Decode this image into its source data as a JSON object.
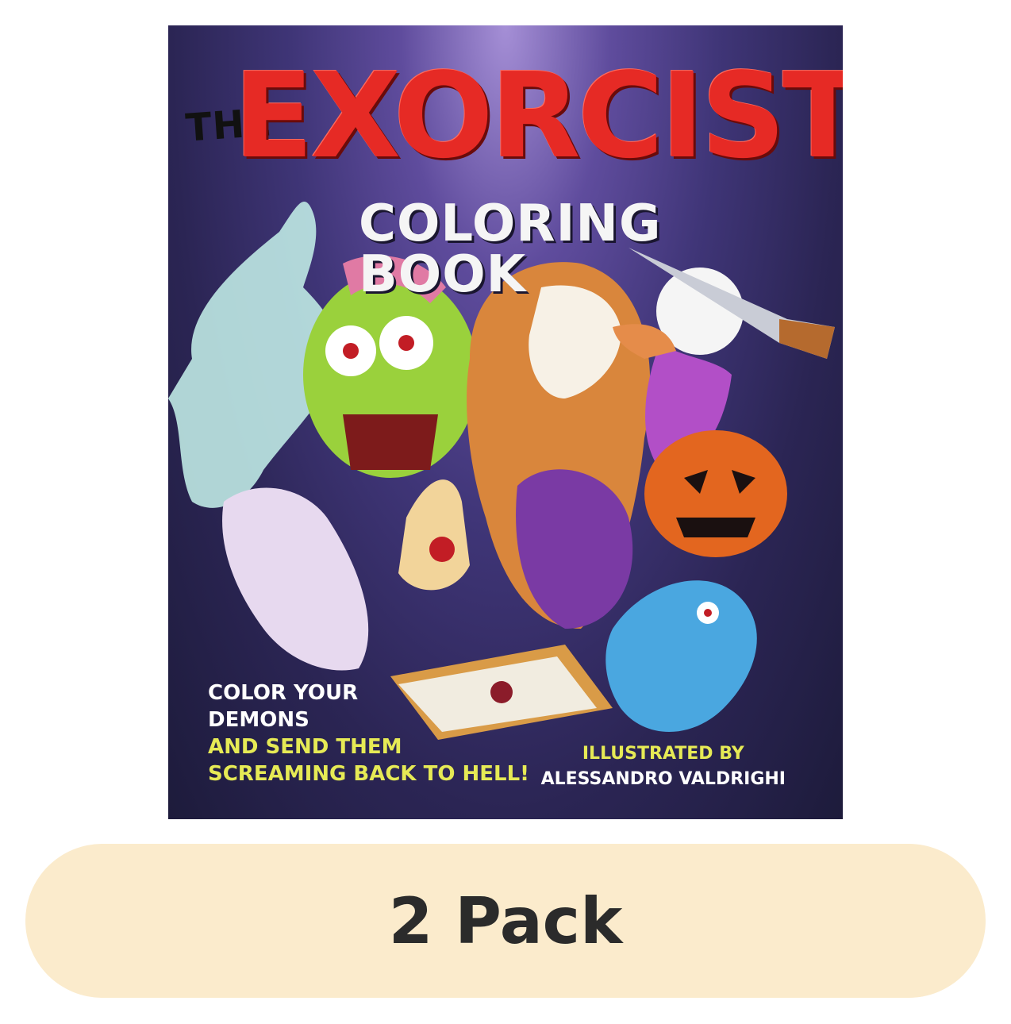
{
  "cover": {
    "title_prefix": "THE",
    "title_main": "EXORCIST'S",
    "title_sub": "COLORING BOOK",
    "tagline_line1": "COLOR YOUR",
    "tagline_line2": "DEMONS",
    "tagline_line3": "AND SEND THEM",
    "tagline_line4": "SCREAMING BACK TO HELL!",
    "credit_label": "ILLUSTRATED BY",
    "credit_name": "ALESSANDRO VALDRIGHI"
  },
  "badge": {
    "label": "2 Pack"
  },
  "colors": {
    "title_red": "#e62a25",
    "accent_yellow": "#e6ea55",
    "badge_bg": "#fbebcc",
    "cover_bg": "#2b2554"
  }
}
